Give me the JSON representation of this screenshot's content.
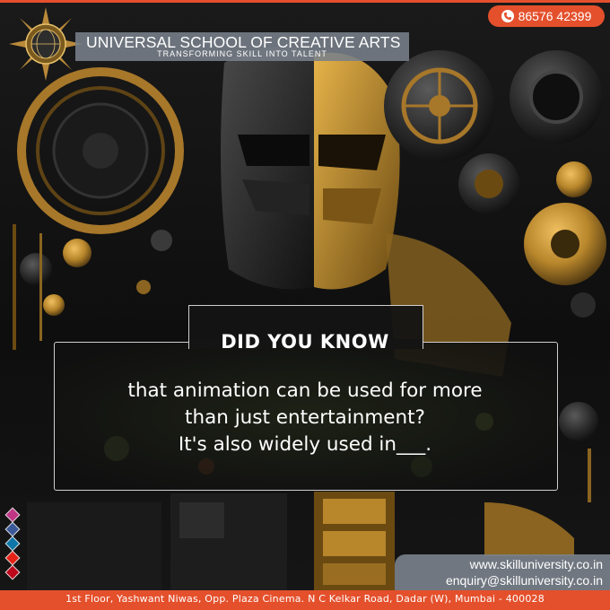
{
  "header": {
    "phone": "86576 42399",
    "school_name": "UNIVERSAL SCHOOL OF CREATIVE ARTS",
    "tagline": "TRANSFORMING  SKILL  INTO  TALENT"
  },
  "card": {
    "heading": "DID YOU KNOW",
    "lines": [
      "that animation can be used for more",
      "than just entertainment?",
      "It's also widely used in___."
    ]
  },
  "contact": {
    "website": "www.skilluniversity.co.in",
    "email": "enquiry@skilluniversity.co.in",
    "address": "1st Floor, Yashwant Niwas, Opp. Plaza Cinema. N C Kelkar Road, Dadar (W), Mumbai - 400028"
  },
  "social_icons": [
    "instagram-icon",
    "facebook-icon",
    "linkedin-icon",
    "youtube-icon",
    "pinterest-icon"
  ],
  "colors": {
    "accent": "#e4502c",
    "banner": "#78808a",
    "gold": "#c9962e",
    "background": "#111111"
  }
}
